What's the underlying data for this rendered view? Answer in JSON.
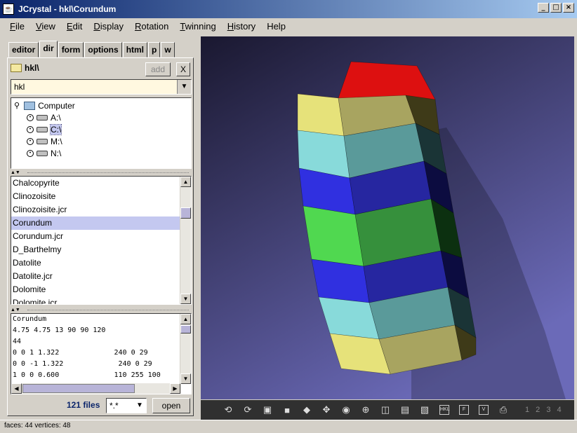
{
  "window": {
    "title": "JCrystal - hkl\\Corundum"
  },
  "menu": [
    {
      "label": "File",
      "key": "F",
      "rest": "ile"
    },
    {
      "label": "View",
      "key": "V",
      "rest": "iew"
    },
    {
      "label": "Edit",
      "key": "E",
      "rest": "dit"
    },
    {
      "label": "Display",
      "key": "D",
      "rest": "isplay"
    },
    {
      "label": "Rotation",
      "key": "R",
      "rest": "otation"
    },
    {
      "label": "Twinning",
      "key": "T",
      "rest": "winning"
    },
    {
      "label": "History",
      "key": "H",
      "rest": "istory"
    },
    {
      "label": "Help",
      "key": "",
      "rest": "Help"
    }
  ],
  "tabs": [
    "editor",
    "dir",
    "form",
    "options",
    "html",
    "p",
    "w"
  ],
  "active_tab": "dir",
  "dir": {
    "path": "hkl\\",
    "add_label": "add",
    "close_label": "X"
  },
  "combo": {
    "value": "hkl"
  },
  "tree": {
    "root": "Computer",
    "drives": [
      "A:\\",
      "C:\\",
      "M:\\",
      "N:\\"
    ],
    "selected_drive": "C:\\"
  },
  "files": [
    "Chalcopyrite",
    "Clinozoisite",
    "Clinozoisite.jcr",
    "Corundum",
    "Corundum.jcr",
    "D_Barthelmy",
    "Datolite",
    "Datolite.jcr",
    "Dolomite",
    "Dolomite.jcr"
  ],
  "selected_file": "Corundum",
  "text_lines": [
    "Corundum",
    "4.75 4.75 13 90 90 120",
    "44",
    "0 0 1 1.322             240 0 29",
    "0 0 -1 1.322             240 0 29",
    "1 0 0 0.600             110 255 100"
  ],
  "bottom": {
    "files_count": "121 files",
    "filter": "*.*",
    "open_label": "open"
  },
  "toolbar": {
    "icons": [
      "rotate-minus-icon",
      "rotate-plus-icon",
      "frame-icon",
      "square-icon",
      "diamond-icon",
      "diamond-arrows-icon",
      "eye-icon",
      "zoom-icon",
      "dual-view-icon",
      "stereo-icon",
      "image-icon",
      "hkl-icon",
      "f-icon",
      "v-icon",
      "print-icon"
    ],
    "hkl_label": "HKL",
    "f_label": "F",
    "v_label": "V",
    "page_nums": "1 2 3 4"
  },
  "status": {
    "text": "faces: 44  vertices: 48"
  },
  "colors": {
    "titlebar_start": "#0a246a",
    "titlebar_end": "#a6caf0",
    "viewer_bg_top": "#1a1830",
    "viewer_bg_bottom": "#6b6ab8",
    "face_top": "#dd1010",
    "yellow_front": "#e6e27a",
    "yellow_mid": "#a8a460",
    "yellow_dark": "#3e3a18",
    "cyan_front": "#88dada",
    "cyan_mid": "#5a9a9a",
    "cyan_dark": "#1a3436",
    "blue_front": "#3030e0",
    "blue_mid": "#2626a0",
    "blue_dark": "#0c0c40",
    "green_front": "#50d850",
    "green_mid": "#36903c",
    "green_dark": "#0c3010"
  }
}
